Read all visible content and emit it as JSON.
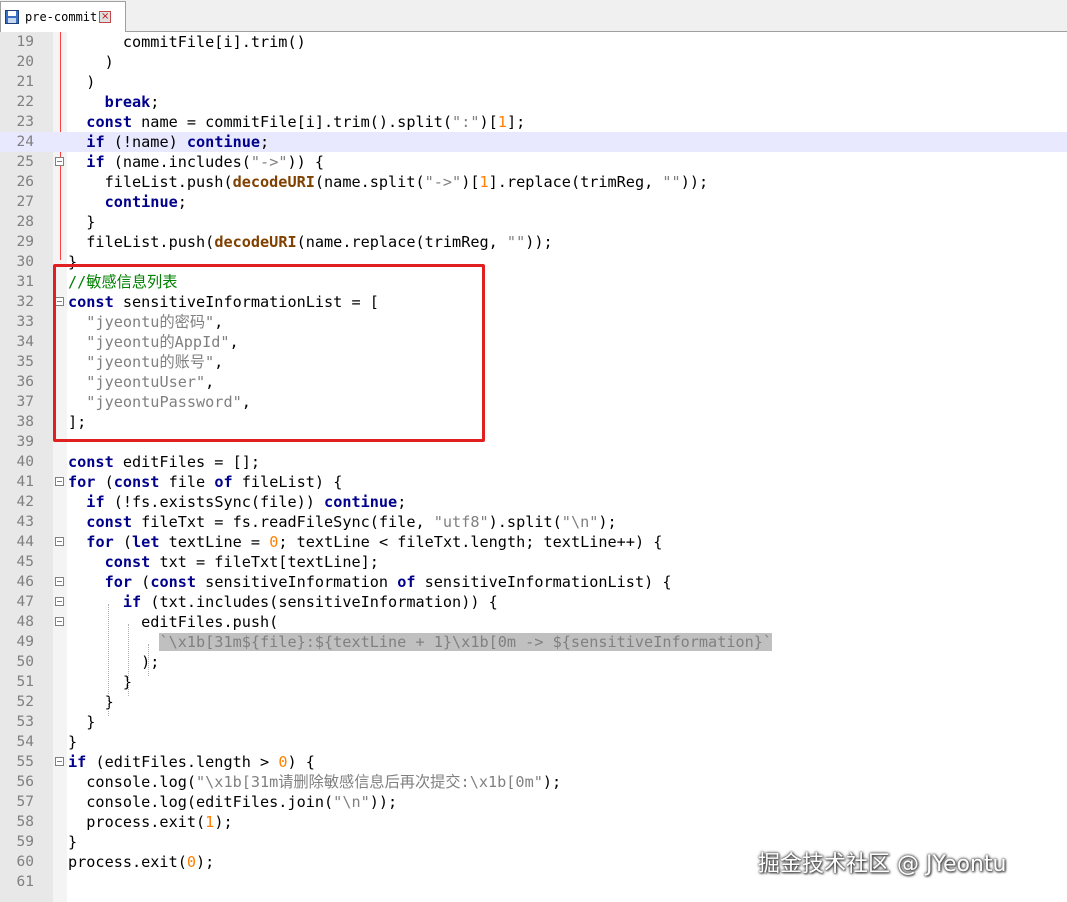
{
  "tab": {
    "filename": "pre-commit",
    "save_icon": "save-icon",
    "close_icon": "close-icon"
  },
  "lines": [
    {
      "n": "19",
      "t": [
        [
          "      commitFile[i].trim()",
          ""
        ]
      ]
    },
    {
      "n": "20",
      "t": [
        [
          "    )",
          ""
        ]
      ]
    },
    {
      "n": "21",
      "t": [
        [
          "  )",
          ""
        ]
      ]
    },
    {
      "n": "22",
      "t": [
        [
          "    ",
          ""
        ],
        [
          "break",
          "kw"
        ],
        [
          ";",
          ""
        ]
      ]
    },
    {
      "n": "23",
      "t": [
        [
          "  ",
          ""
        ],
        [
          "const",
          "kw"
        ],
        [
          " name = commitFile[i].trim().split(",
          ""
        ],
        [
          "\":\"",
          "str"
        ],
        [
          ")[",
          ""
        ],
        [
          "1",
          "num"
        ],
        [
          "];",
          ""
        ]
      ]
    },
    {
      "n": "24",
      "t": [
        [
          "  ",
          ""
        ],
        [
          "if",
          "kw"
        ],
        [
          " (!name) ",
          ""
        ],
        [
          "continue",
          "kw"
        ],
        [
          ";",
          ""
        ]
      ],
      "current": true
    },
    {
      "n": "25",
      "t": [
        [
          "  ",
          ""
        ],
        [
          "if",
          "kw"
        ],
        [
          " (name.includes(",
          ""
        ],
        [
          "\"->\"",
          "str"
        ],
        [
          ")) {",
          ""
        ]
      ],
      "fold": true
    },
    {
      "n": "26",
      "t": [
        [
          "    fileList.push(",
          ""
        ],
        [
          "decodeURI",
          "fn"
        ],
        [
          "(name.split(",
          ""
        ],
        [
          "\"->\"",
          "str"
        ],
        [
          ")[",
          ""
        ],
        [
          "1",
          "num"
        ],
        [
          "].replace(trimReg, ",
          ""
        ],
        [
          "\"\"",
          "str"
        ],
        [
          "));",
          ""
        ]
      ]
    },
    {
      "n": "27",
      "t": [
        [
          "    ",
          ""
        ],
        [
          "continue",
          "kw"
        ],
        [
          ";",
          ""
        ]
      ]
    },
    {
      "n": "28",
      "t": [
        [
          "  }",
          ""
        ]
      ]
    },
    {
      "n": "29",
      "t": [
        [
          "  fileList.push(",
          ""
        ],
        [
          "decodeURI",
          "fn"
        ],
        [
          "(name.replace(trimReg, ",
          ""
        ],
        [
          "\"\"",
          "str"
        ],
        [
          "));",
          ""
        ]
      ]
    },
    {
      "n": "30",
      "t": [
        [
          "}",
          ""
        ]
      ]
    },
    {
      "n": "31",
      "t": [
        [
          "//敏感信息列表",
          "cmt"
        ]
      ]
    },
    {
      "n": "32",
      "t": [
        [
          "const",
          "kw"
        ],
        [
          " sensitiveInformationList = [",
          ""
        ]
      ],
      "fold": true
    },
    {
      "n": "33",
      "t": [
        [
          "  ",
          ""
        ],
        [
          "\"jyeontu的密码\"",
          "str"
        ],
        [
          ",",
          ""
        ]
      ]
    },
    {
      "n": "34",
      "t": [
        [
          "  ",
          ""
        ],
        [
          "\"jyeontu的AppId\"",
          "str"
        ],
        [
          ",",
          ""
        ]
      ]
    },
    {
      "n": "35",
      "t": [
        [
          "  ",
          ""
        ],
        [
          "\"jyeontu的账号\"",
          "str"
        ],
        [
          ",",
          ""
        ]
      ]
    },
    {
      "n": "36",
      "t": [
        [
          "  ",
          ""
        ],
        [
          "\"jyeontuUser\"",
          "str"
        ],
        [
          ",",
          ""
        ]
      ]
    },
    {
      "n": "37",
      "t": [
        [
          "  ",
          ""
        ],
        [
          "\"jyeontuPassword\"",
          "str"
        ],
        [
          ",",
          ""
        ]
      ]
    },
    {
      "n": "38",
      "t": [
        [
          "];",
          ""
        ]
      ]
    },
    {
      "n": "39",
      "t": [
        [
          "",
          ""
        ]
      ]
    },
    {
      "n": "40",
      "t": [
        [
          "const",
          "kw"
        ],
        [
          " editFiles = [];",
          ""
        ]
      ]
    },
    {
      "n": "41",
      "t": [
        [
          "for",
          "kw"
        ],
        [
          " (",
          ""
        ],
        [
          "const",
          "kw"
        ],
        [
          " file ",
          ""
        ],
        [
          "of",
          "kw"
        ],
        [
          " fileList) {",
          ""
        ]
      ],
      "fold": true
    },
    {
      "n": "42",
      "t": [
        [
          "  ",
          ""
        ],
        [
          "if",
          "kw"
        ],
        [
          " (!fs.existsSync(file)) ",
          ""
        ],
        [
          "continue",
          "kw"
        ],
        [
          ";",
          ""
        ]
      ]
    },
    {
      "n": "43",
      "t": [
        [
          "  ",
          ""
        ],
        [
          "const",
          "kw"
        ],
        [
          " fileTxt = fs.readFileSync(file, ",
          ""
        ],
        [
          "\"utf8\"",
          "str"
        ],
        [
          ").split(",
          ""
        ],
        [
          "\"\\n\"",
          "str"
        ],
        [
          ");",
          ""
        ]
      ]
    },
    {
      "n": "44",
      "t": [
        [
          "  ",
          ""
        ],
        [
          "for",
          "kw"
        ],
        [
          " (",
          ""
        ],
        [
          "let",
          "kw"
        ],
        [
          " textLine = ",
          ""
        ],
        [
          "0",
          "num"
        ],
        [
          "; textLine < fileTxt.length; textLine++) {",
          ""
        ]
      ],
      "fold": true
    },
    {
      "n": "45",
      "t": [
        [
          "    ",
          ""
        ],
        [
          "const",
          "kw"
        ],
        [
          " txt = fileTxt[textLine];",
          ""
        ]
      ]
    },
    {
      "n": "46",
      "t": [
        [
          "    ",
          ""
        ],
        [
          "for",
          "kw"
        ],
        [
          " (",
          ""
        ],
        [
          "const",
          "kw"
        ],
        [
          " sensitiveInformation ",
          ""
        ],
        [
          "of",
          "kw"
        ],
        [
          " sensitiveInformationList) {",
          ""
        ]
      ],
      "fold": true
    },
    {
      "n": "47",
      "t": [
        [
          "      ",
          ""
        ],
        [
          "if",
          "kw"
        ],
        [
          " (txt.includes(sensitiveInformation)) {",
          ""
        ]
      ],
      "fold": true
    },
    {
      "n": "48",
      "t": [
        [
          "        editFiles.push(",
          ""
        ]
      ],
      "fold": true
    },
    {
      "n": "49",
      "t": [
        [
          "          ",
          ""
        ],
        [
          "`\\x1b[31m${file}:${textLine + 1}\\x1b[0m -> ${sensitiveInformation}`",
          "str hl"
        ]
      ]
    },
    {
      "n": "50",
      "t": [
        [
          "        );",
          ""
        ]
      ]
    },
    {
      "n": "51",
      "t": [
        [
          "      }",
          ""
        ]
      ]
    },
    {
      "n": "52",
      "t": [
        [
          "    }",
          ""
        ]
      ]
    },
    {
      "n": "53",
      "t": [
        [
          "  }",
          ""
        ]
      ]
    },
    {
      "n": "54",
      "t": [
        [
          "}",
          ""
        ]
      ]
    },
    {
      "n": "55",
      "t": [
        [
          "if",
          "kw"
        ],
        [
          " (editFiles.length > ",
          ""
        ],
        [
          "0",
          "num"
        ],
        [
          ") {",
          ""
        ]
      ],
      "fold": true
    },
    {
      "n": "56",
      "t": [
        [
          "  console.log(",
          ""
        ],
        [
          "\"\\x1b[31m请删除敏感信息后再次提交:\\x1b[0m\"",
          "str"
        ],
        [
          ");",
          ""
        ]
      ]
    },
    {
      "n": "57",
      "t": [
        [
          "  console.log(editFiles.join(",
          ""
        ],
        [
          "\"\\n\"",
          "str"
        ],
        [
          "));",
          ""
        ]
      ]
    },
    {
      "n": "58",
      "t": [
        [
          "  process.exit(",
          ""
        ],
        [
          "1",
          "num"
        ],
        [
          ");",
          ""
        ]
      ]
    },
    {
      "n": "59",
      "t": [
        [
          "}",
          ""
        ]
      ]
    },
    {
      "n": "60",
      "t": [
        [
          "process.exit(",
          ""
        ],
        [
          "0",
          "num"
        ],
        [
          ");",
          ""
        ]
      ]
    },
    {
      "n": "61",
      "t": [
        [
          "",
          ""
        ]
      ]
    }
  ],
  "colors": {
    "keyword": "#00008b",
    "string": "#808080",
    "number": "#ff8000",
    "comment": "#008000",
    "function": "#804000",
    "current_line": "#e8e8ff",
    "highlight_box": "#e02020"
  },
  "watermark": "掘金技术社区 @ JYeontu"
}
